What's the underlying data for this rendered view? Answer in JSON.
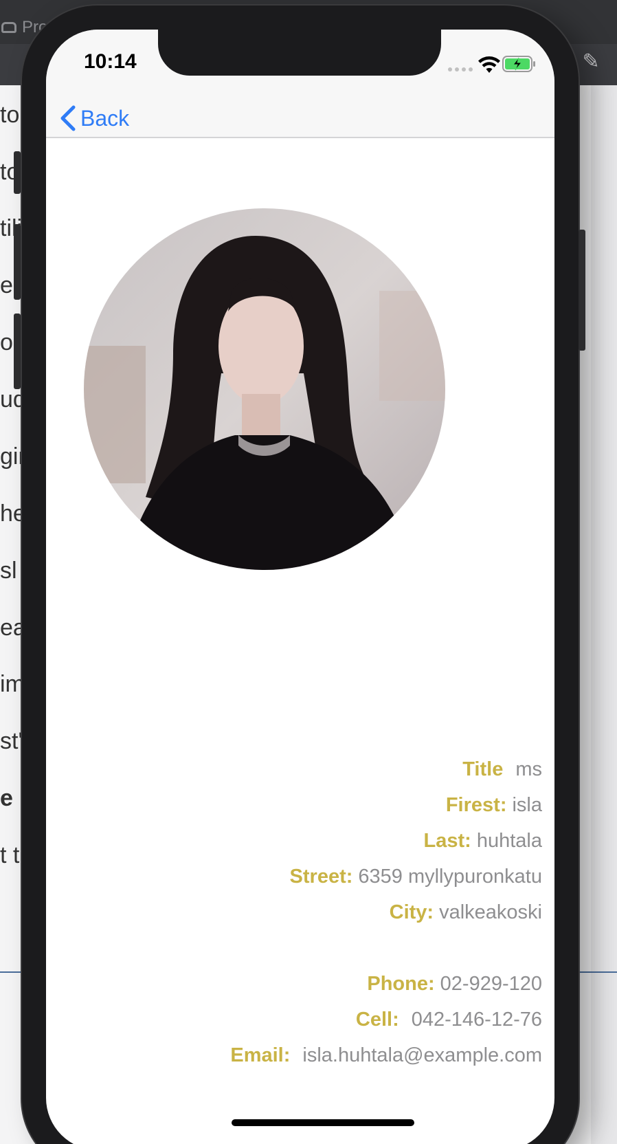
{
  "background": {
    "tab_label": "Pro",
    "doc_lines": [
      "to",
      "to",
      "tili",
      "eg",
      "op",
      "ude",
      "gin",
      "her",
      "sl",
      "ead",
      "im",
      "st'",
      "e r",
      "t t"
    ]
  },
  "status_bar": {
    "time": "10:14"
  },
  "nav": {
    "back_label": "Back"
  },
  "person": {
    "title_label": "Title",
    "title_value": "ms",
    "first_label": "Firest:",
    "first_value": "isla",
    "last_label": "Last:",
    "last_value": "huhtala",
    "street_label": "Street:",
    "street_value": "6359 myllypuronkatu",
    "city_label": "City:",
    "city_value": "valkeakoski",
    "phone_label": "Phone:",
    "phone_value": "02-929-120",
    "cell_label": "Cell:",
    "cell_value": "042-146-12-76",
    "email_label": "Email:",
    "email_value": "isla.huhtala@example.com"
  },
  "colors": {
    "accent_blue": "#2f7cf6",
    "label_gold": "#c9b345",
    "value_gray": "#8e8e90"
  },
  "icons": [
    "chevron-left-icon",
    "wifi-icon",
    "battery-charging-icon",
    "pen-icon"
  ]
}
